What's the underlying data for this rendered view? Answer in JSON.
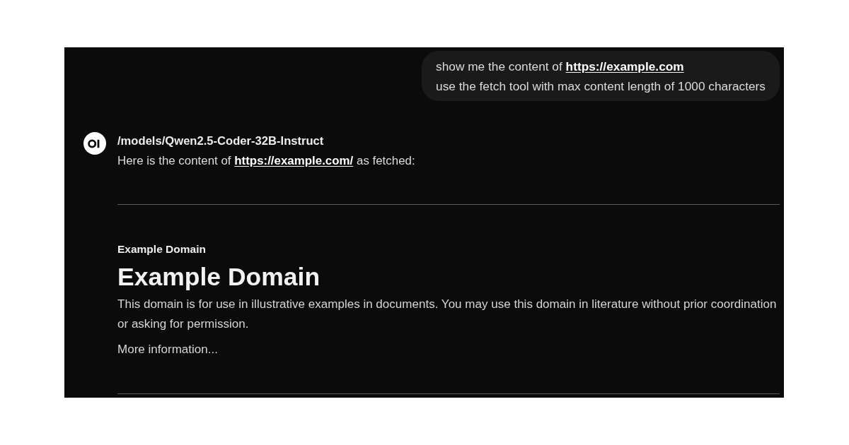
{
  "user_message": {
    "lines": [
      {
        "parts": [
          {
            "kind": "text",
            "text": "show me the content of"
          },
          {
            "kind": "link",
            "text": "https://example.com"
          }
        ]
      },
      {
        "parts": [
          {
            "kind": "text",
            "text": "use the fetch tool with max content length of 1000 characters"
          }
        ]
      }
    ]
  },
  "assistant_message": {
    "model_name": "/models/Qwen2.5-Coder-32B-Instruct",
    "intro": {
      "parts": [
        {
          "kind": "text",
          "text": "Here is the content of"
        },
        {
          "kind": "link",
          "text": "https://example.com/"
        },
        {
          "kind": "text",
          "text": "as fetched:"
        }
      ]
    },
    "fetched_page": {
      "page_title": "Example Domain",
      "heading": "Example Domain",
      "paragraphs": [
        "This domain is for use in illustrative examples in documents. You may use this domain in literature without prior coordination or asking for permission.",
        "More information..."
      ]
    }
  }
}
